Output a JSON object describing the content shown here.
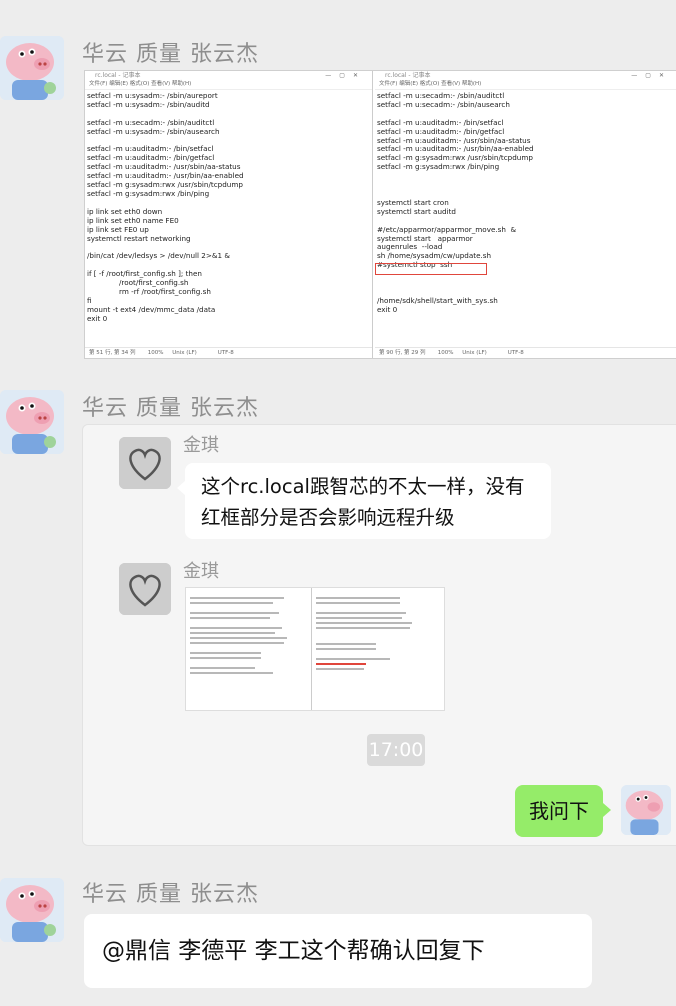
{
  "messages": [
    {
      "sender": "华云 质量 张云杰",
      "notepad_left": {
        "title": "rc.local - 记事本",
        "menu": "文件(F)  编辑(E)  格式(O)  查看(V)  帮助(H)",
        "lines": [
          "setfacl -m u:sysadm:- /sbin/aureport",
          "setfacl -m u:sysadm:- /sbin/auditd",
          "",
          "setfacl -m u:secadm:- /sbin/auditctl",
          "setfacl -m u:sysadm:- /sbin/ausearch",
          "",
          "setfacl -m u:auditadm:- /bin/setfacl",
          "setfacl -m u:auditadm:- /bin/getfacl",
          "setfacl -m u:auditadm:- /usr/sbin/aa-status",
          "setfacl -m u:auditadm:- /usr/bin/aa-enabled",
          "setfacl -m g:sysadm:rwx /usr/sbin/tcpdump",
          "setfacl -m g:sysadm:rwx /bin/ping",
          "",
          "ip link set eth0 down",
          "ip link set eth0 name FE0",
          "ip link set FE0 up",
          "systemctl restart networking",
          "",
          "/bin/cat /dev/ledsys > /dev/null 2>&1 &",
          "",
          "if [ -f /root/first_config.sh ]; then",
          "              /root/first_config.sh",
          "              rm -rf /root/first_config.sh",
          "fi",
          "mount -t ext4 /dev/mmc_data /data",
          "exit 0"
        ],
        "status": "第 51 行, 第 34 列       100%     Unix (LF)            UTF-8"
      },
      "notepad_right": {
        "title": "rc.local - 记事本",
        "menu": "文件(F)  编辑(E)  格式(O)  查看(V)  帮助(H)",
        "lines": [
          "setfacl -m u:secadm:- /sbin/auditctl",
          "setfacl -m u:secadm:- /sbin/ausearch",
          "",
          "setfacl -m u:auditadm:- /bin/setfacl",
          "setfacl -m u:auditadm:- /bin/getfacl",
          "setfacl -m u:auditadm:- /usr/sbin/aa-status",
          "setfacl -m u:auditadm:- /usr/bin/aa-enabled",
          "setfacl -m g:sysadm:rwx /usr/sbin/tcpdump",
          "setfacl -m g:sysadm:rwx /bin/ping",
          "",
          "",
          "",
          "systemctl start cron",
          "systemctl start auditd",
          "",
          "#/etc/apparmor/apparmor_move.sh  &",
          "systemctl start   apparmor",
          "augenrules  --load",
          "sh /home/sysadm/cw/update.sh",
          "#systemctl stop  ssh",
          "",
          "",
          "",
          "/home/sdk/shell/start_with_sys.sh",
          "exit 0"
        ],
        "status": "第 90 行, 第 29 列       100%     Unix (LF)            UTF-8"
      }
    },
    {
      "sender": "华云 质量 张云杰",
      "forwarded": {
        "name1": "金琪",
        "text": "这个rc.local跟智芯的不太一样，没有红框部分是否会影响远程升级",
        "name2": "金琪",
        "time": "17:00",
        "reply": "我问下"
      }
    },
    {
      "sender": "华云 质量 张云杰",
      "text": "@鼎信 李德平 李工这个帮确认回复下"
    }
  ]
}
